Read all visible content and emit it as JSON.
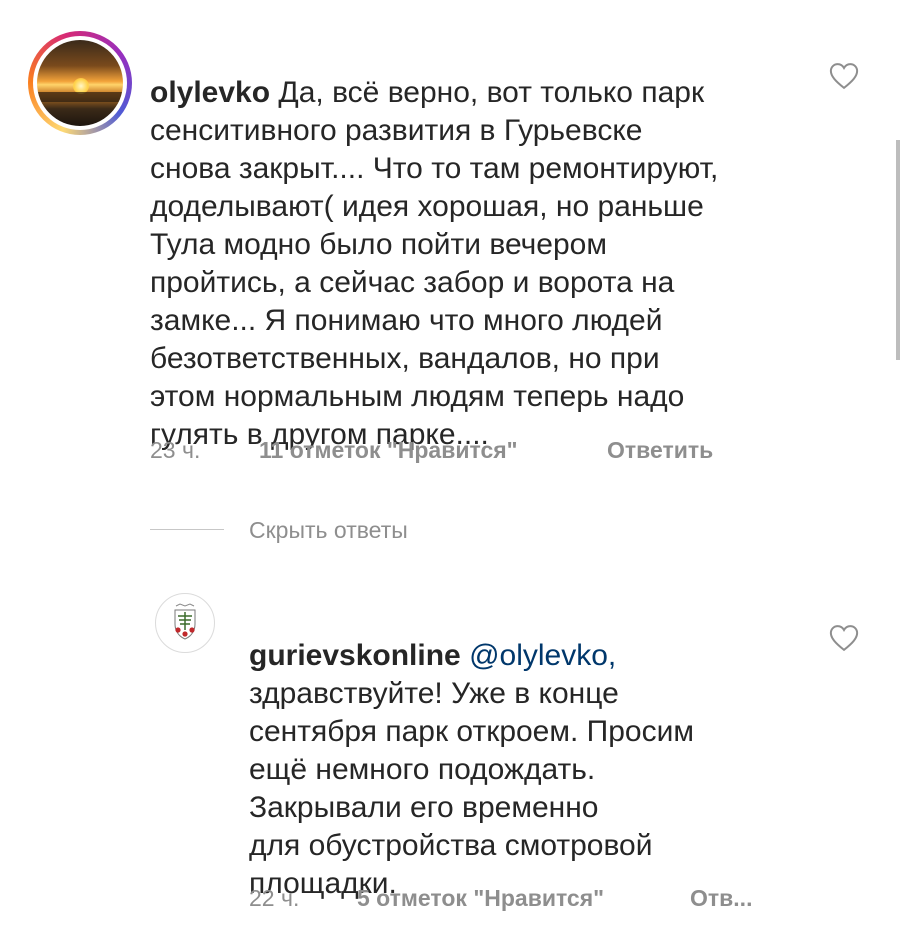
{
  "comment": {
    "username": "olylevko",
    "text": " Да, всё верно, вот только парк\nсенситивного развития в Гурьевске\nснова закрыт.... Что то там ремонтируют,\nдоделывают( идея хорошая, но раньше\nТула модно было пойти вечером\nпройтись, а сейчас забор и ворота на\nзамке... Я понимаю что много людей\nбезответственных, вандалов, но при\nэтом нормальным людям теперь надо\nгулять в другом парке....",
    "time": "23 ч.",
    "likes": "11 отметок \"Нравится\"",
    "reply": "Ответить"
  },
  "replies_toggle": "Скрыть ответы",
  "reply_comment": {
    "username": "gurievskonline",
    "mention": "@olylevko,",
    "text": "здравствуйте! Уже в конце\nсентября парк откроем. Просим\nещё немного подождать.\nЗакрывали его временно\nдля обустройства смотровой\nплощадки.",
    "time": "22 ч.",
    "likes": "5 отметок \"Нравится\"",
    "reply": "Отв..."
  },
  "icons": {
    "like": "heart-outline-icon",
    "avatar_logo": "city-emblem-icon"
  },
  "colors": {
    "text": "#262626",
    "meta": "#8e8e8e",
    "mention": "#00376b"
  }
}
